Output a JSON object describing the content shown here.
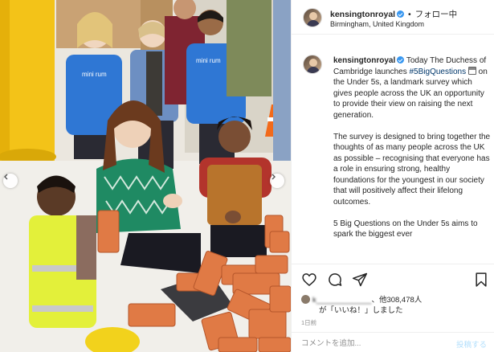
{
  "post": {
    "username": "kensingtonroyal",
    "separator": "•",
    "follow_label": "フォロー中",
    "location": "Birmingham, United Kingdom",
    "caption": {
      "username": "kensingtonroyal",
      "p1_part1": "Today The Duchess of Cambridge launches ",
      "p1_hashtag": "#5BigQuestions",
      "p1_part2": " on the Under 5s, a landmark survey which gives people across the UK an opportunity to provide their view on raising the next generation.",
      "p2": "The survey is designed to bring together the thoughts of as many people across the UK as possible – recognising that everyone has a role in ensuring strong, healthy foundations for the youngest in our society that will positively affect their lifelong outcomes.",
      "p3": "5 Big Questions on the Under 5s aims to spark the biggest ever"
    },
    "likes": {
      "liker_name": "k_____________",
      "liker_suffix": "、他308,478人",
      "line2": "が「いいね！」しました"
    },
    "time": "1日前",
    "comment": {
      "placeholder": "コメントを追加...",
      "post_label": "投稿する"
    }
  },
  "photo": {
    "shirt_text": "mini rum"
  },
  "icons": {
    "like": "heart-icon",
    "comment": "comment-icon",
    "share": "share-icon",
    "bookmark": "bookmark-icon",
    "verified": "verified-badge-icon",
    "prev": "chevron-left-icon",
    "next": "chevron-right-icon"
  },
  "colors": {
    "verified": "#3897f0",
    "hashtag": "#00376b",
    "muted": "#8e8e8e",
    "post_button": "#b2dffc"
  }
}
